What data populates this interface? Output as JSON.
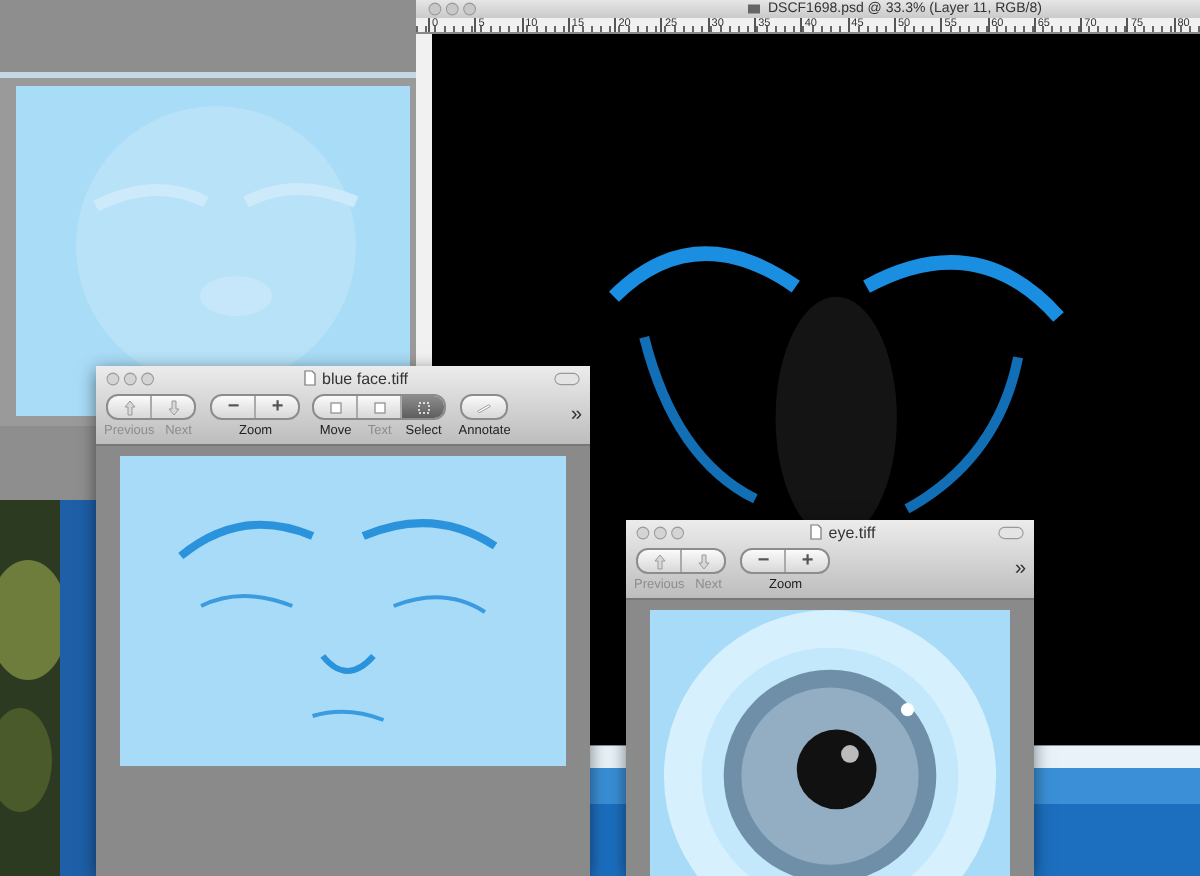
{
  "windows": [
    {
      "kind": "photoshop",
      "title": "DSCF1698.psd @ 33.3% (Layer 11, RGB/8)",
      "ruler": [
        "0",
        "5",
        "10",
        "15",
        "20",
        "25",
        "30",
        "35",
        "40",
        "45",
        "50",
        "55",
        "60",
        "65",
        "70",
        "75",
        "80"
      ]
    },
    {
      "kind": "preview",
      "title": "blue face.tiff",
      "toolbar": [
        {
          "kind": "nav",
          "items": [
            {
              "text": "Previous",
              "disabled": true
            },
            {
              "text": "Next",
              "disabled": true
            }
          ]
        },
        {
          "kind": "zoom",
          "label": "Zoom",
          "keys": [
            "−",
            "+"
          ]
        },
        {
          "kind": "tools",
          "items": [
            {
              "text": "Move",
              "disabled": false,
              "selected": false
            },
            {
              "text": "Text",
              "disabled": true,
              "selected": false
            },
            {
              "text": "Select",
              "disabled": false,
              "selected": true
            }
          ]
        },
        {
          "kind": "annotate",
          "label": "Annotate"
        }
      ],
      "overflow": "»"
    },
    {
      "kind": "preview",
      "title": "eye.tiff",
      "toolbar": [
        {
          "kind": "nav",
          "items": [
            {
              "text": "Previous",
              "disabled": true
            },
            {
              "text": "Next",
              "disabled": true
            }
          ]
        },
        {
          "kind": "zoom",
          "label": "Zoom",
          "keys": [
            "−",
            "+"
          ]
        }
      ],
      "overflow": "»"
    }
  ]
}
